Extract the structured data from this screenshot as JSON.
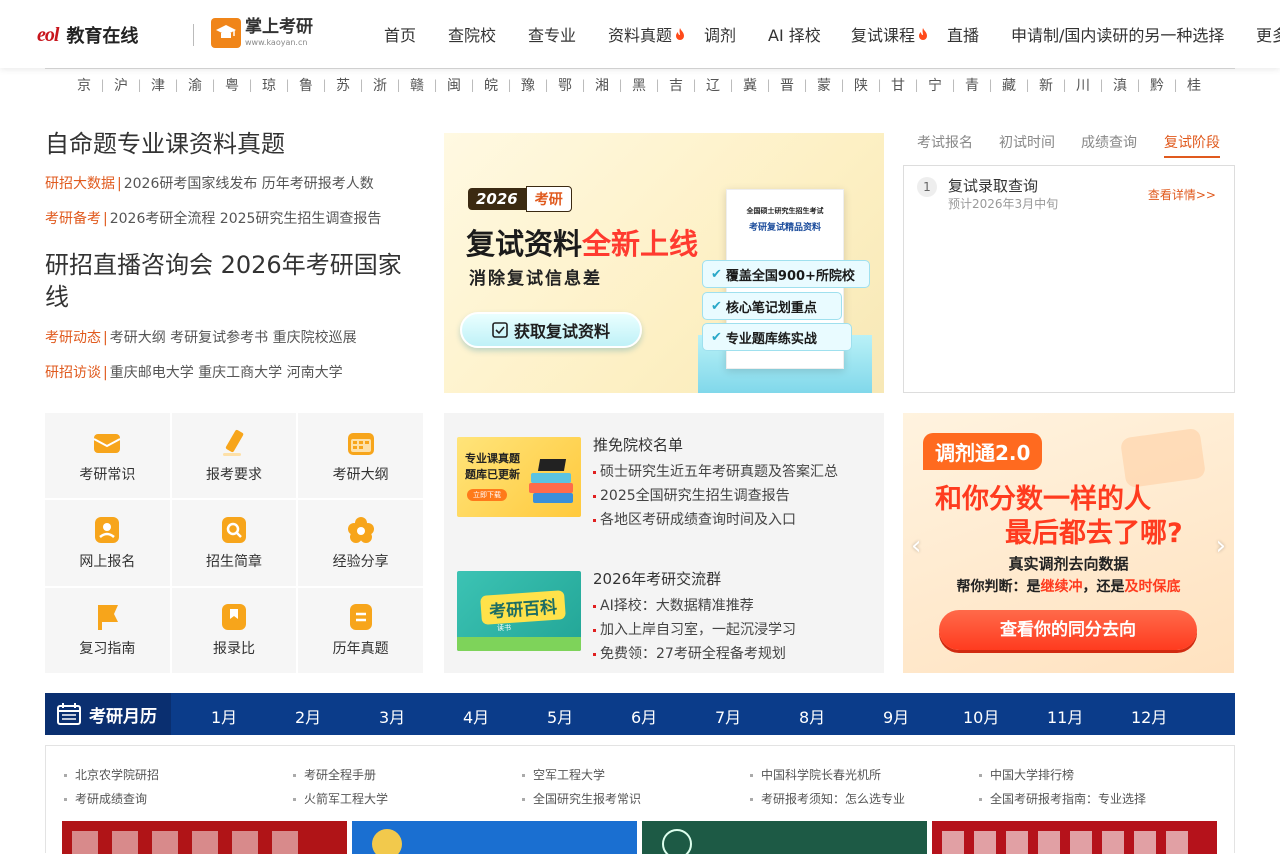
{
  "header": {
    "eol_logo": "eol",
    "eol_name": "教育在线",
    "kaoyan_name": "掌上考研",
    "kaoyan_url": "www.kaoyan.cn",
    "nav": [
      {
        "label": "首页",
        "hot": false
      },
      {
        "label": "查院校",
        "hot": false
      },
      {
        "label": "查专业",
        "hot": false
      },
      {
        "label": "资料真题",
        "hot": true
      },
      {
        "label": "调剂",
        "hot": false
      },
      {
        "label": "AI 择校",
        "hot": false
      },
      {
        "label": "复试课程",
        "hot": true
      },
      {
        "label": "直播",
        "hot": false
      },
      {
        "label": "申请制/国内读研的另一种选择",
        "hot": false
      },
      {
        "label": "更多",
        "hot": false
      }
    ]
  },
  "provinces": [
    "京",
    "沪",
    "津",
    "渝",
    "粤",
    "琼",
    "鲁",
    "苏",
    "浙",
    "赣",
    "闽",
    "皖",
    "豫",
    "鄂",
    "湘",
    "黑",
    "吉",
    "辽",
    "冀",
    "晋",
    "蒙",
    "陕",
    "甘",
    "宁",
    "青",
    "藏",
    "新",
    "川",
    "滇",
    "黔",
    "桂"
  ],
  "headlines": {
    "title1": "自命题专业课资料真题",
    "row1": {
      "cat": "研招大数据",
      "text": "2026研考国家线发布 历年考研报考人数"
    },
    "row2": {
      "cat": "考研备考",
      "text": "2026考研全流程 2025研究生招生调查报告"
    },
    "title2": "研招直播咨询会 2026年考研国家线",
    "row3": {
      "cat": "考研动态",
      "text": "考研大纲 考研复试参考书 重庆院校巡展"
    },
    "row4": {
      "cat": "研招访谈",
      "text": "重庆邮电大学 重庆工商大学 河南大学"
    }
  },
  "banner": {
    "year": "2026",
    "tag": "考研",
    "title_a": "复试资料",
    "title_b": "全新上线",
    "subtitle": "消除复试信息差",
    "button": "获取复试资料",
    "book_title1": "全国硕士研究生招生考试",
    "book_title2": "考研复试精品资料",
    "features": [
      "覆盖全国900+所院校",
      "核心笔记划重点",
      "专业题库练实战"
    ]
  },
  "sidebox": {
    "tabs": [
      "考试报名",
      "初试时间",
      "成绩查询",
      "复试阶段"
    ],
    "active_tab": 3,
    "item": {
      "num": "1",
      "title": "复试录取查询",
      "sub": "预计2026年3月中旬",
      "link": "查看详情>>"
    }
  },
  "grid": [
    {
      "label": "考研常识",
      "icon": "envelope-icon"
    },
    {
      "label": "报考要求",
      "icon": "pencil-icon"
    },
    {
      "label": "考研大纲",
      "icon": "calendar-icon"
    },
    {
      "label": "网上报名",
      "icon": "user-card-icon"
    },
    {
      "label": "招生简章",
      "icon": "search-doc-icon"
    },
    {
      "label": "经验分享",
      "icon": "flower-icon"
    },
    {
      "label": "复习指南",
      "icon": "flag-icon"
    },
    {
      "label": "报录比",
      "icon": "bookmark-icon"
    },
    {
      "label": "历年真题",
      "icon": "document-icon"
    }
  ],
  "promos": [
    {
      "img_text1": "专业课真题",
      "img_text2": "题库已更新",
      "img_btn": "立即下载",
      "title": "推免院校名单",
      "lines": [
        "硕士研究生近五年考研真题及答案汇总",
        "2025全国研究生招生调查报告",
        "各地区考研成绩查询时间及入口"
      ]
    },
    {
      "img_text1": "考研百科",
      "img_text2": "读书",
      "title": "2026年考研交流群",
      "lines": [
        "AI择校：大数据精准推荐",
        "加入上岸自习室，一起沉浸学习",
        "免费领：27考研全程备考规划"
      ]
    }
  ],
  "ad": {
    "badge": "调剂通2.0",
    "line1": "和你分数一样的人",
    "line2": "最后都去了哪?",
    "line3": "真实调剂去向数据",
    "line4_a": "帮你判断：是",
    "line4_b": "继续冲",
    "line4_c": "，还是",
    "line4_d": "及时保底",
    "button": "查看你的同分去向",
    "prev": "‹",
    "next": "›"
  },
  "calendar": {
    "title": "考研月历",
    "months": [
      "1月",
      "2月",
      "3月",
      "4月",
      "5月",
      "6月",
      "7月",
      "8月",
      "9月",
      "10月",
      "11月",
      "12月"
    ]
  },
  "links": [
    [
      "北京农学院研招",
      "考研成绩查询"
    ],
    [
      "考研全程手册",
      "火箭军工程大学"
    ],
    [
      "空军工程大学",
      "全国研究生报考常识"
    ],
    [
      "中国科学院长春光机所",
      "考研报考须知：怎么选专业"
    ],
    [
      "中国大学排行榜",
      "全国考研报考指南：专业选择"
    ]
  ],
  "colors": {
    "accent": "#e05a1e",
    "brand_orange": "#f08519",
    "calendar_blue": "#0b3c8a",
    "logo_red": "#c8161d"
  }
}
